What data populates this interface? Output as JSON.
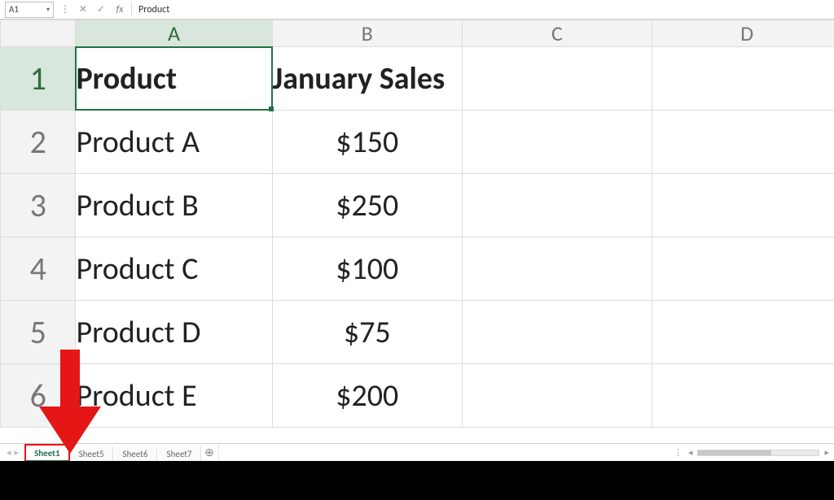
{
  "formula_bar": {
    "name_box": "A1",
    "cancel_glyph": "✕",
    "enter_glyph": "✓",
    "fx_label": "fx",
    "content": "Product"
  },
  "columns": [
    "A",
    "B",
    "C",
    "D"
  ],
  "rows": [
    "1",
    "2",
    "3",
    "4",
    "5",
    "6"
  ],
  "selected_cell": "A1",
  "cells": {
    "r1": {
      "A": "Product",
      "B": "January Sales",
      "C": "",
      "D": ""
    },
    "r2": {
      "A": "Product A",
      "B": "$150",
      "C": "",
      "D": ""
    },
    "r3": {
      "A": "Product B",
      "B": "$250",
      "C": "",
      "D": ""
    },
    "r4": {
      "A": "Product C",
      "B": "$100",
      "C": "",
      "D": ""
    },
    "r5": {
      "A": "Product D",
      "B": "$75",
      "C": "",
      "D": ""
    },
    "r6": {
      "A": "Product E",
      "B": "$200",
      "C": "",
      "D": ""
    }
  },
  "tabs": {
    "items": [
      "Sheet1",
      "Sheet5",
      "Sheet6",
      "Sheet7"
    ],
    "active_index": 0,
    "add_glyph": "⊕"
  },
  "nav": {
    "first": "◂",
    "prev": "▸"
  }
}
